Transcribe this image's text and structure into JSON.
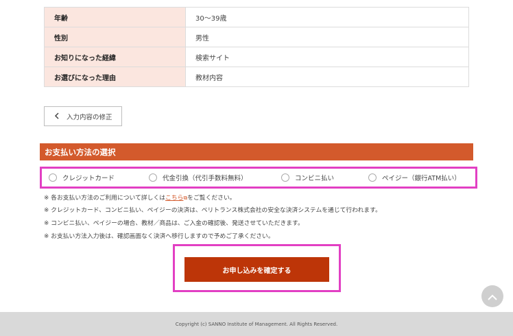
{
  "summary": {
    "rows": [
      {
        "label": "年齢",
        "value": "30～39歳"
      },
      {
        "label": "性別",
        "value": "男性"
      },
      {
        "label": "お知りになった経緯",
        "value": "検索サイト"
      },
      {
        "label": "お選びになった理由",
        "value": "教材内容"
      }
    ]
  },
  "back_button": {
    "label": "入力内容の修正"
  },
  "payment": {
    "title": "お支払い方法の選択",
    "options": [
      {
        "label": "クレジットカード"
      },
      {
        "label": "代金引換（代引手数料無料）"
      },
      {
        "label": "コンビニ払い"
      },
      {
        "label": "ペイジー（銀行ATM払い）"
      }
    ],
    "notes": {
      "n1_prefix": "※ 各お支払い方法のご利用について詳しくは",
      "n1_link": "こちら",
      "n1_suffix": "をご覧ください。",
      "n2": "※ クレジットカード、コンビニ払い、ペイジーの決済は、ベリトランス株式会社の安全な決済システムを通じて行われます。",
      "n3": "※ コンビニ払い、ペイジーの場合、教材／商品は、ご入金の確認後、発送させていただきます。",
      "n4": "※ お支払い方法入力後は、確認画面なく決済へ移行しますので予めご了承ください。"
    }
  },
  "confirm_button": {
    "label": "お申し込みを確定する"
  },
  "footer": {
    "copyright": "Copyright (c) SANNO Institute of Management. All Rights Reserved."
  },
  "colors": {
    "accent": "#d35a2c",
    "confirm": "#bd3508",
    "label_bg": "#fbe6df",
    "highlight": "#e23fc3",
    "footer_bg": "#d9d9d9"
  },
  "icons": {
    "back": "chevron-left-icon",
    "external_link": "external-link-icon",
    "scroll_top": "chevron-up-icon"
  }
}
